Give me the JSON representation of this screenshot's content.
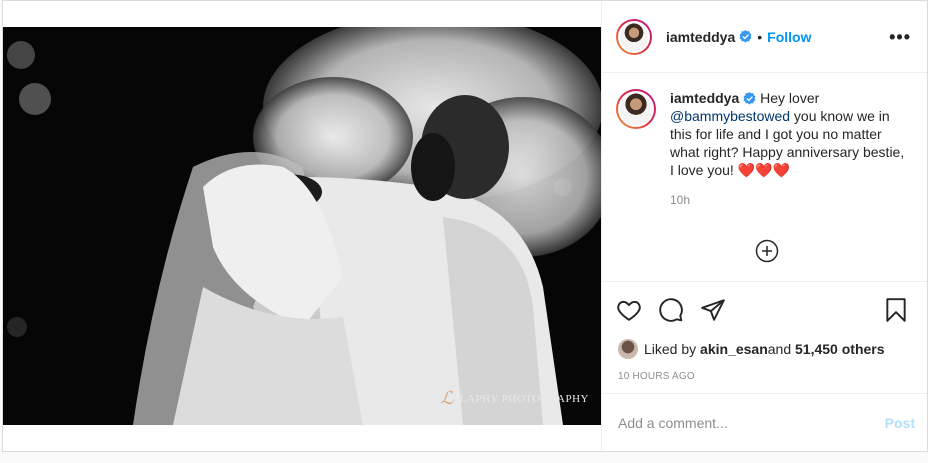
{
  "author": {
    "username": "iamteddya",
    "verified": true,
    "follow_label": "Follow",
    "separator": "•"
  },
  "caption": {
    "username": "iamteddya",
    "text_before": "Hey lover ",
    "mention": "@bammybestowed",
    "text_after": " you know we in this for life and I got you no matter what right? Happy anniversary bestie, I love you! ",
    "hearts": "❤️❤️❤️",
    "time": "10h"
  },
  "photo": {
    "watermark": "LAPHY PHOTOGRAPHY",
    "watermark_mark": "ℒ"
  },
  "likes": {
    "prefix": "Liked by ",
    "user": "akin_esan",
    "middle": " and ",
    "count": "51,450 others"
  },
  "posted_ago": "10 HOURS AGO",
  "comment": {
    "placeholder": "Add a comment...",
    "post_label": "Post"
  },
  "icons": {
    "more": "more-options-icon",
    "like": "heart-icon",
    "comment": "comment-icon",
    "share": "share-icon",
    "save": "bookmark-icon",
    "load_more": "plus-circle-icon"
  },
  "colors": {
    "follow": "#0095f6",
    "mention": "#00376b",
    "post_disabled": "#b2dffc",
    "muted": "#8e8e8e"
  }
}
